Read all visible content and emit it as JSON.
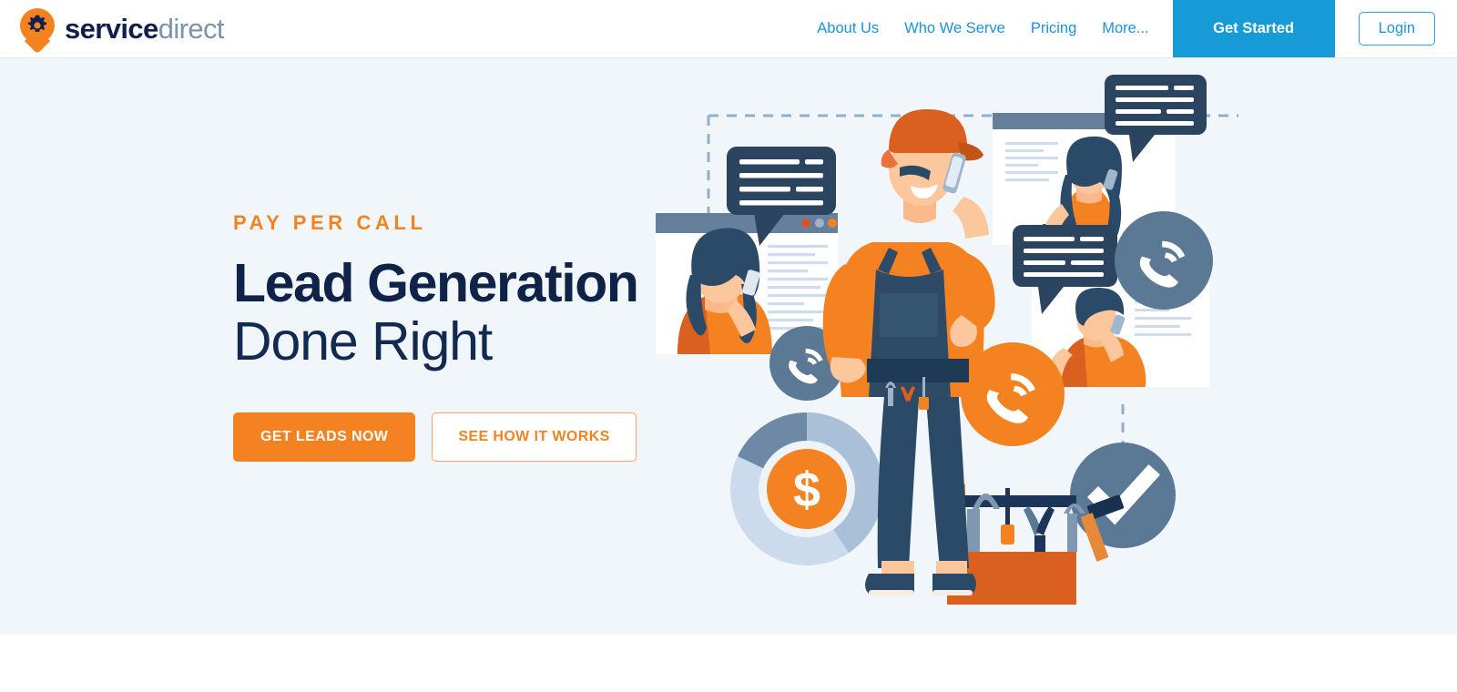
{
  "brand": {
    "logo_icon": "map-pin-gear-icon",
    "name_primary": "service",
    "name_secondary": "direct",
    "color_orange": "#f58220",
    "color_navy": "#10204b",
    "color_blue": "#169bd7"
  },
  "header": {
    "nav": [
      {
        "label": "About Us",
        "name": "about-us"
      },
      {
        "label": "Who We Serve",
        "name": "who-we-serve"
      },
      {
        "label": "Pricing",
        "name": "pricing"
      },
      {
        "label": "More...",
        "name": "more"
      }
    ],
    "get_started_label": "Get Started",
    "login_label": "Login"
  },
  "hero": {
    "eyebrow": "PAY PER CALL",
    "headline_line1": "Lead Generation",
    "headline_line2": "Done Right",
    "primary_cta": "GET LEADS NOW",
    "secondary_cta": "SEE HOW IT WORKS",
    "background_color": "#f1f6fb",
    "illustration": {
      "name": "pay-per-call-lead-generation-illustration",
      "alt": "Technician on phone surrounded by browser windows with customers calling, phone icons, donut chart with dollar sign, toolbox and checkmark"
    }
  }
}
